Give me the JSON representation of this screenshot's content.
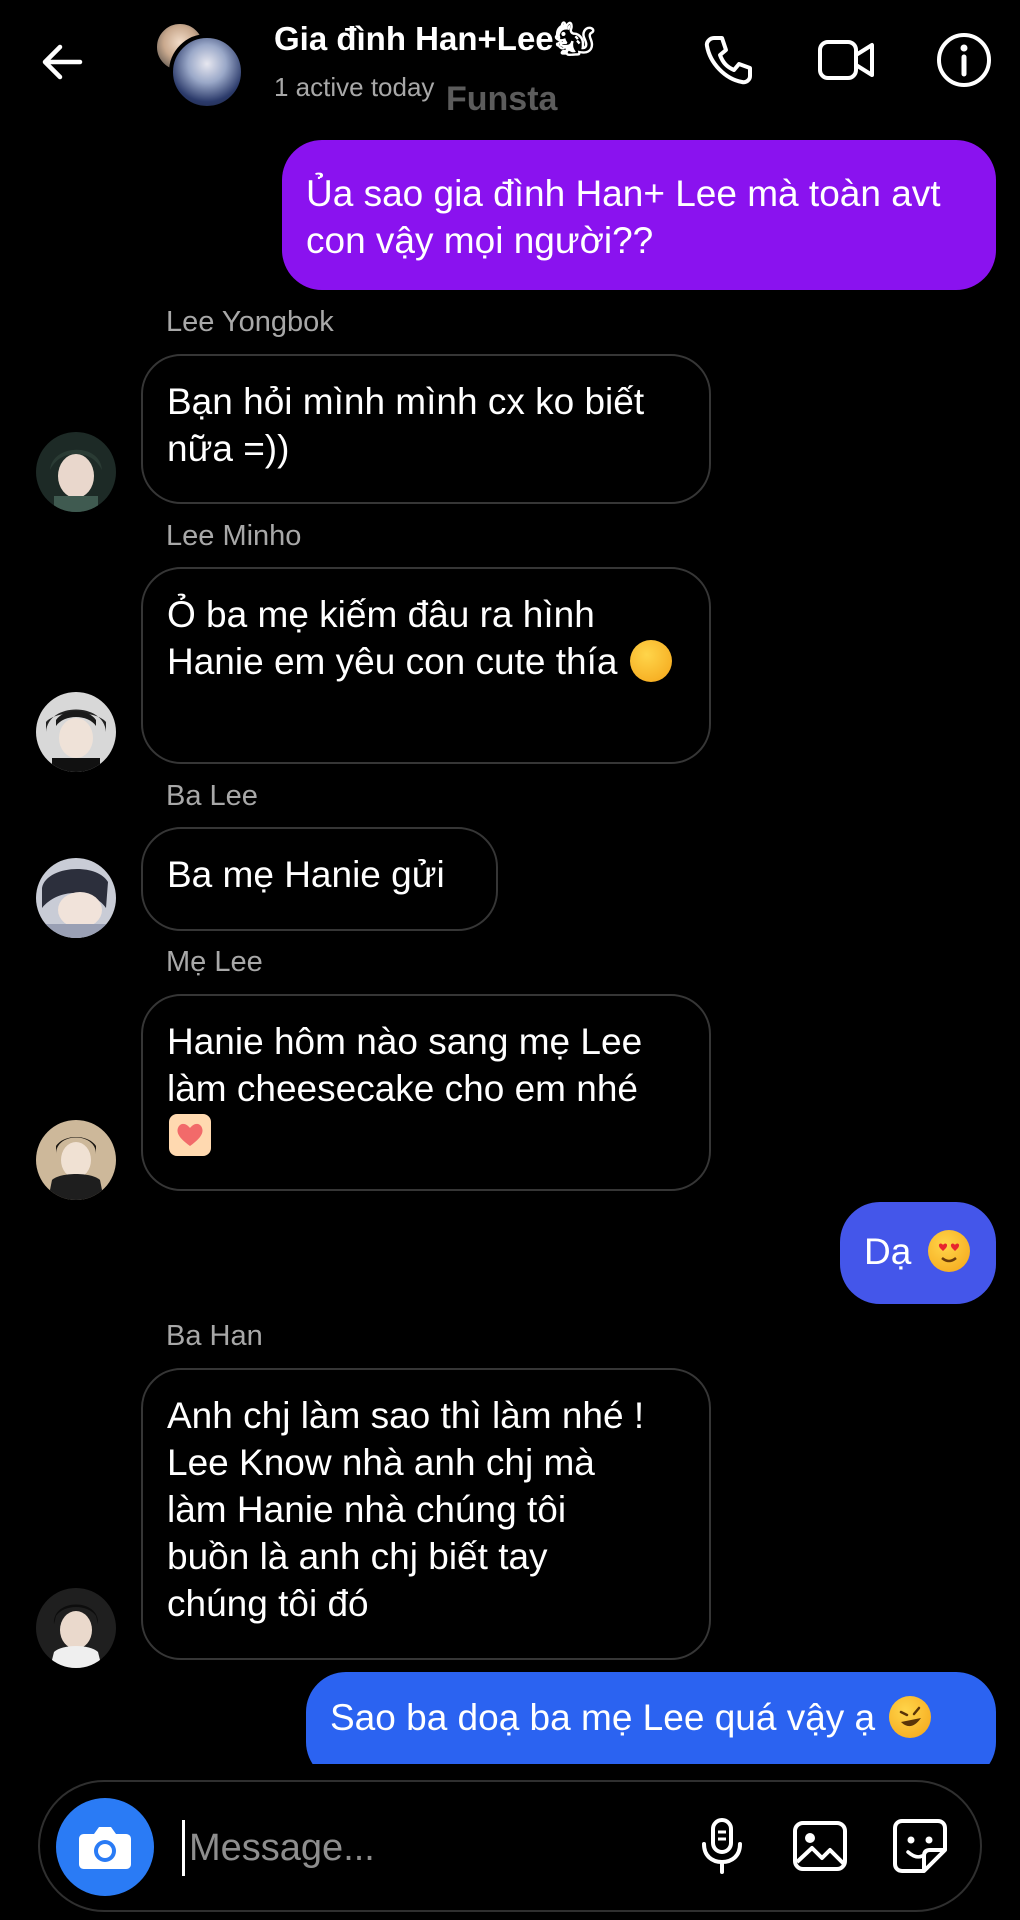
{
  "header": {
    "title": "Gia đình Han+Lee🐿",
    "status": "1 active today",
    "watermark": "Funsta"
  },
  "messages": [
    {
      "type": "outgoing",
      "text": "Ủa sao gia đình Han+ Lee mà toàn avt con vậy mọi người??",
      "color": "#8a12ef"
    },
    {
      "type": "incoming",
      "sender": "Lee Yongbok",
      "text": "Bạn hỏi mình mình cx ko biết nữa =))"
    },
    {
      "type": "incoming",
      "sender": "Lee Minho",
      "text": "Ỏ ba mẹ kiếm đâu ra hình Hanie em yêu con cute thía",
      "emoji": "smirk-face"
    },
    {
      "type": "incoming",
      "sender": "Ba Lee",
      "text": "Ba mẹ Hanie gửi"
    },
    {
      "type": "incoming",
      "sender": "Mẹ Lee",
      "text": "Hanie hôm nào sang mẹ Lee làm cheesecake cho em nhé",
      "emoji": "heart-hands"
    },
    {
      "type": "outgoing",
      "text": "Dạ",
      "emoji": "heart-eyes-cat",
      "color": "#4456ea"
    },
    {
      "type": "incoming",
      "sender": "Ba Han",
      "text": "Anh chj làm sao thì làm nhé ! Lee Know nhà anh chj mà làm Hanie nhà chúng tôi buồn là anh chj biết tay chúng tôi đó"
    },
    {
      "type": "outgoing",
      "text": "Sao ba doạ ba mẹ Lee quá vậy ạ",
      "emoji": "rofl-face",
      "color": "#2b63f1"
    }
  ],
  "composer": {
    "placeholder": "Message..."
  },
  "colors": {
    "background": "#000000",
    "incoming_border": "#363636",
    "camera_button": "#2a7bf5",
    "secondary_text": "#a8a8a8"
  },
  "icons": [
    "back-arrow-icon",
    "phone-icon",
    "video-camera-icon",
    "info-icon",
    "camera-icon",
    "microphone-icon",
    "gallery-icon",
    "sticker-icon"
  ]
}
